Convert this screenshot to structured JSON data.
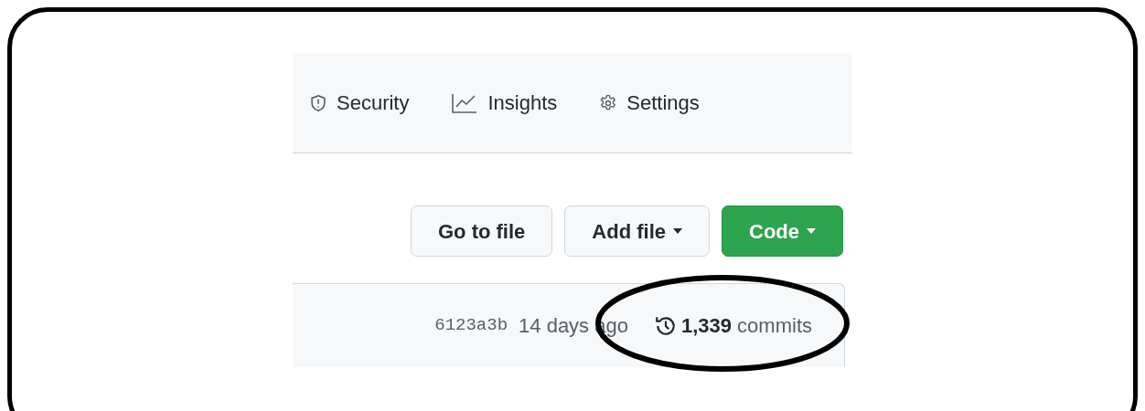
{
  "tabs": [
    {
      "kind": "shield",
      "label": "Security"
    },
    {
      "kind": "graph",
      "label": "Insights"
    },
    {
      "kind": "gear",
      "label": "Settings"
    }
  ],
  "buttons": [
    {
      "label": "Go to file",
      "primary": false,
      "caret": false
    },
    {
      "label": "Add file",
      "primary": false,
      "caret": true
    },
    {
      "label": "Code",
      "primary": true,
      "caret": true
    }
  ],
  "commit": {
    "sha": "6123a3b",
    "time": "14 days ago",
    "count": "**1,339** commits"
  },
  "annotation": {
    "circled": true
  }
}
